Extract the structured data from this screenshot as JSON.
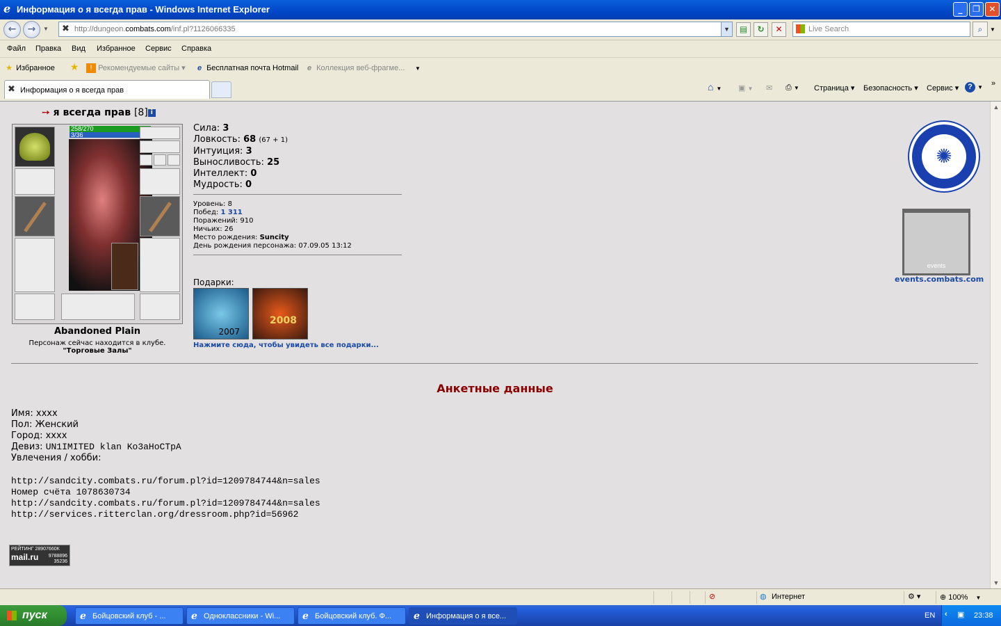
{
  "window": {
    "title": "Информация о я всегда прав - Windows Internet Explorer"
  },
  "address": {
    "url_prefix": "http://dungeon.",
    "url_domain": "combats.com",
    "url_path": "/inf.pl?1126066335"
  },
  "search": {
    "placeholder": "Live Search"
  },
  "menu": [
    "Файл",
    "Правка",
    "Вид",
    "Избранное",
    "Сервис",
    "Справка"
  ],
  "favbar": {
    "favorites": "Избранное",
    "recommended": "Рекомендуемые сайты",
    "hotmail": "Бесплатная почта Hotmail",
    "webslice": "Коллекция веб-фрагме..."
  },
  "tab": {
    "title": "Информация о я всегда прав"
  },
  "toolbar": {
    "page": "Страница",
    "security": "Безопасность",
    "service": "Сервис"
  },
  "character": {
    "name": "я всегда прав",
    "level": "[8]",
    "hp": "258/270",
    "mp": "3/36",
    "location": "Abandoned Plain",
    "club_note": "Персонаж сейчас находится в клубе.",
    "club_name": "\"Торговые Залы\""
  },
  "stats": [
    {
      "label": "Сила:",
      "value": "3",
      "extra": ""
    },
    {
      "label": "Ловкость:",
      "value": "68",
      "extra": "(67 + 1)"
    },
    {
      "label": "Интуиция:",
      "value": "3",
      "extra": ""
    },
    {
      "label": "Выносливость:",
      "value": "25",
      "extra": ""
    },
    {
      "label": "Интеллект:",
      "value": "0",
      "extra": ""
    },
    {
      "label": "Мудрость:",
      "value": "0",
      "extra": ""
    }
  ],
  "info": {
    "level_label": "Уровень:",
    "level": "8",
    "wins_label": "Побед:",
    "wins": "1 311",
    "losses_label": "Поражений:",
    "losses": "910",
    "draws_label": "Ничьих:",
    "draws": "26",
    "birthplace_label": "Место рождения:",
    "birthplace": "Suncity",
    "birthday_label": "День рождения персонажа:",
    "birthday": "07.09.05 13:12"
  },
  "gifts": {
    "label": "Подарки:",
    "gift1": "2007",
    "gift2": "2008",
    "link": "Нажмите сюда, чтобы увидеть все подарки..."
  },
  "events": {
    "emblem_text": "events",
    "link": "events.combats.com"
  },
  "profile": {
    "title": "Анкетные данные",
    "name_label": "Имя:",
    "name": "xxxx",
    "sex_label": "Пол:",
    "sex": "Женский",
    "city_label": "Город:",
    "city": "xxxx",
    "motto_label": "Девиз:",
    "motto": "UN1IMITED klan Ko3aHoCTpA",
    "hobby_label": "Увлечения / хобби:",
    "lines": [
      "http://sandcity.combats.ru/forum.pl?id=1209784744&n=sales",
      "Номер счёта 1078630734",
      "http://sandcity.combats.ru/forum.pl?id=1209784744&n=sales",
      "http://services.ritterclan.org/dressroom.php?id=56962"
    ]
  },
  "counter": {
    "line1": "РЕЙТИНГ 28907660К",
    "brand": "mail.ru",
    "n1": "9788896",
    "n2": "35236"
  },
  "status": {
    "zone": "Интернет",
    "zoom": "100%"
  },
  "taskbar": {
    "start": "пуск",
    "tasks": [
      "Бойцовский клуб - ...",
      "Одноклассники - Wi...",
      "Бойцовский клуб. Ф...",
      "Информация о я все..."
    ],
    "lang": "EN",
    "time": "23:38"
  },
  "colors": {
    "title_bar": "#0046c8",
    "page_bg": "#e2e0e0",
    "link": "#1a4aa8",
    "section_title": "#8b0000"
  }
}
